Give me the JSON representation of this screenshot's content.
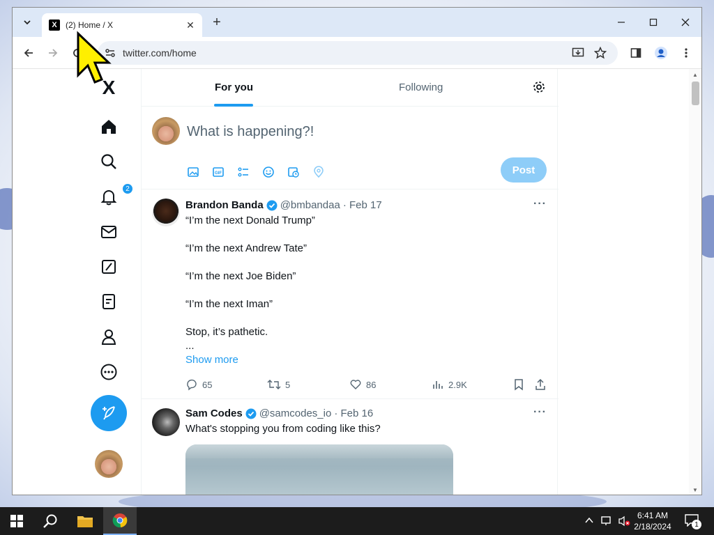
{
  "browser": {
    "tab_title": "(2) Home / X",
    "tab_favicon": "X",
    "new_tab_label": "+",
    "close_tab_label": "✕",
    "url": "twitter.com/home",
    "icons": [
      "tab-search-icon",
      "back-icon",
      "forward-icon",
      "reload-icon",
      "site-info-icon",
      "install-icon",
      "star-icon",
      "side-panel-icon",
      "profile-icon",
      "menu-icon",
      "minimize-icon",
      "maximize-icon",
      "close-icon"
    ]
  },
  "sidebar": {
    "logo": "X",
    "notifications_count": "2",
    "items": [
      "home",
      "explore",
      "notifications",
      "messages",
      "grok",
      "lists",
      "profile",
      "more"
    ]
  },
  "feed": {
    "tabs": [
      "For you",
      "Following"
    ],
    "composer": {
      "placeholder": "What is happening?!",
      "post_label": "Post"
    },
    "tweets": [
      {
        "name": "Brandon Banda",
        "handle": "@bmbandaa",
        "date": "· Feb 17",
        "lines": [
          "“I’m the next Donald Trump”",
          "“I’m the next Andrew Tate”",
          "“I’m the next Joe Biden”",
          "“I’m the next Iman”",
          "Stop, it’s pathetic.",
          "..."
        ],
        "show_more": "Show more",
        "replies": "65",
        "reposts": "5",
        "likes": "86",
        "views": "2.9K"
      },
      {
        "name": "Sam Codes",
        "handle": "@samcodes_io",
        "date": "· Feb 16",
        "lines": [
          "What's stopping you from coding like this?"
        ]
      }
    ]
  },
  "taskbar": {
    "time": "6:41 AM",
    "date": "2/18/2024",
    "notification_count": "1"
  },
  "colors": {
    "accent": "#1d9bf0",
    "post_disabled": "#8ecdf8",
    "tabstrip": "#dde8f7",
    "taskbar": "#1c1c1c"
  }
}
